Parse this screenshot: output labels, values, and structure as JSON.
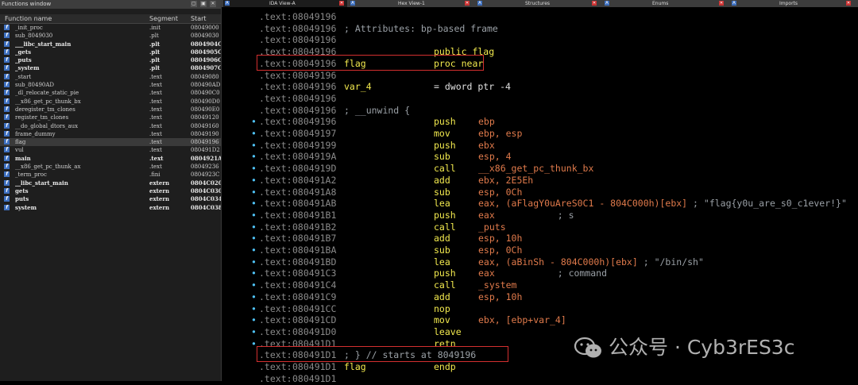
{
  "functions_window": {
    "title": "Functions window",
    "columns": {
      "name": "Function name",
      "segment": "Segment",
      "start": "Start"
    },
    "rows": [
      {
        "name": "_init_proc",
        "segment": ".init",
        "start": "08049000",
        "bold": false
      },
      {
        "name": "sub_8049030",
        "segment": ".plt",
        "start": "08049030",
        "bold": false
      },
      {
        "name": "___libc_start_main",
        "segment": ".plt",
        "start": "0804904C",
        "bold": true
      },
      {
        "name": "_gets",
        "segment": ".plt",
        "start": "0804905C",
        "bold": true
      },
      {
        "name": "_puts",
        "segment": ".plt",
        "start": "0804906C",
        "bold": true
      },
      {
        "name": "_system",
        "segment": ".plt",
        "start": "0804907C",
        "bold": true
      },
      {
        "name": "_start",
        "segment": ".text",
        "start": "08049080",
        "bold": false
      },
      {
        "name": "sub_80490AD",
        "segment": ".text",
        "start": "080490AD",
        "bold": false
      },
      {
        "name": "_dl_relocate_static_pie",
        "segment": ".text",
        "start": "080490C0",
        "bold": false
      },
      {
        "name": "__x86_get_pc_thunk_bx",
        "segment": ".text",
        "start": "080490D0",
        "bold": false
      },
      {
        "name": "deregister_tm_clones",
        "segment": ".text",
        "start": "080490E0",
        "bold": false
      },
      {
        "name": "register_tm_clones",
        "segment": ".text",
        "start": "08049120",
        "bold": false
      },
      {
        "name": "__do_global_dtors_aux",
        "segment": ".text",
        "start": "08049160",
        "bold": false
      },
      {
        "name": "frame_dummy",
        "segment": ".text",
        "start": "08049190",
        "bold": false
      },
      {
        "name": "flag",
        "segment": ".text",
        "start": "08049196",
        "bold": false,
        "selected": true
      },
      {
        "name": "vul",
        "segment": ".text",
        "start": "080491D2",
        "bold": false
      },
      {
        "name": "main",
        "segment": ".text",
        "start": "0804921A",
        "bold": true
      },
      {
        "name": "__x86_get_pc_thunk_ax",
        "segment": ".text",
        "start": "08049236",
        "bold": false
      },
      {
        "name": "_term_proc",
        "segment": ".fini",
        "start": "0804923C",
        "bold": false
      },
      {
        "name": "__libc_start_main",
        "segment": "extern",
        "start": "0804C020",
        "bold": true
      },
      {
        "name": "gets",
        "segment": "extern",
        "start": "0804C030",
        "bold": true
      },
      {
        "name": "puts",
        "segment": "extern",
        "start": "0804C034",
        "bold": true
      },
      {
        "name": "system",
        "segment": "extern",
        "start": "0804C038",
        "bold": true
      }
    ]
  },
  "tabs": [
    {
      "label": "IDA View-A",
      "active": true
    },
    {
      "label": "Hex View-1",
      "active": false
    },
    {
      "label": "Structures",
      "active": false
    },
    {
      "label": "Enums",
      "active": false
    },
    {
      "label": "Imports",
      "active": false
    }
  ],
  "disasm": [
    {
      "seg": ".text:",
      "addr": "08049196"
    },
    {
      "seg": ".text:",
      "addr": "08049196",
      "comment": "; Attributes: bp-based frame"
    },
    {
      "seg": ".text:",
      "addr": "08049196"
    },
    {
      "seg": ".text:",
      "addr": "08049196",
      "mnemonic": "public flag"
    },
    {
      "seg": ".text:",
      "addr": "08049196",
      "label": "flag",
      "mnemonic": "proc near"
    },
    {
      "seg": ".text:",
      "addr": "08049196"
    },
    {
      "seg": ".text:",
      "addr": "08049196",
      "label": "var_4",
      "mnemonic_raw": "= dword ptr -4"
    },
    {
      "seg": ".text:",
      "addr": "08049196"
    },
    {
      "seg": ".text:",
      "addr": "08049196",
      "comment": "; __unwind {"
    },
    {
      "seg": ".text:",
      "addr": "08049196",
      "dot": true,
      "mnemonic": "push",
      "operand": "ebp"
    },
    {
      "seg": ".text:",
      "addr": "08049197",
      "dot": true,
      "mnemonic": "mov",
      "operand": "ebp, esp"
    },
    {
      "seg": ".text:",
      "addr": "08049199",
      "dot": true,
      "mnemonic": "push",
      "operand": "ebx"
    },
    {
      "seg": ".text:",
      "addr": "0804919A",
      "dot": true,
      "mnemonic": "sub",
      "operand": "esp, 4"
    },
    {
      "seg": ".text:",
      "addr": "0804919D",
      "dot": true,
      "mnemonic": "call",
      "operand": "__x86_get_pc_thunk_bx"
    },
    {
      "seg": ".text:",
      "addr": "080491A2",
      "dot": true,
      "mnemonic": "add",
      "operand": "ebx, 2E5Eh"
    },
    {
      "seg": ".text:",
      "addr": "080491A8",
      "dot": true,
      "mnemonic": "sub",
      "operand": "esp, 0Ch"
    },
    {
      "seg": ".text:",
      "addr": "080491AB",
      "dot": true,
      "mnemonic": "lea",
      "operand": "eax, (aFlagY0uAreS0C1 - 804C000h)[ebx]",
      "comment": "; \"flag{y0u_are_s0_c1ever!}\""
    },
    {
      "seg": ".text:",
      "addr": "080491B1",
      "dot": true,
      "mnemonic": "push",
      "operand": "eax",
      "comment": "; s"
    },
    {
      "seg": ".text:",
      "addr": "080491B2",
      "dot": true,
      "mnemonic": "call",
      "operand": "_puts"
    },
    {
      "seg": ".text:",
      "addr": "080491B7",
      "dot": true,
      "mnemonic": "add",
      "operand": "esp, 10h"
    },
    {
      "seg": ".text:",
      "addr": "080491BA",
      "dot": true,
      "mnemonic": "sub",
      "operand": "esp, 0Ch"
    },
    {
      "seg": ".text:",
      "addr": "080491BD",
      "dot": true,
      "mnemonic": "lea",
      "operand": "eax, (aBinSh - 804C000h)[ebx]",
      "comment": "; \"/bin/sh\""
    },
    {
      "seg": ".text:",
      "addr": "080491C3",
      "dot": true,
      "mnemonic": "push",
      "operand": "eax",
      "comment": "; command"
    },
    {
      "seg": ".text:",
      "addr": "080491C4",
      "dot": true,
      "mnemonic": "call",
      "operand": "_system"
    },
    {
      "seg": ".text:",
      "addr": "080491C9",
      "dot": true,
      "mnemonic": "add",
      "operand": "esp, 10h"
    },
    {
      "seg": ".text:",
      "addr": "080491CC",
      "dot": true,
      "mnemonic": "nop"
    },
    {
      "seg": ".text:",
      "addr": "080491CD",
      "dot": true,
      "mnemonic": "mov",
      "operand": "ebx, [ebp+var_4]"
    },
    {
      "seg": ".text:",
      "addr": "080491D0",
      "dot": true,
      "mnemonic": "leave"
    },
    {
      "seg": ".text:",
      "addr": "080491D1",
      "dot": true,
      "mnemonic": "retn"
    },
    {
      "seg": ".text:",
      "addr": "080491D1",
      "comment": "; } // starts at 8049196"
    },
    {
      "seg": ".text:",
      "addr": "080491D1",
      "label": "flag",
      "mnemonic": "endp"
    },
    {
      "seg": ".text:",
      "addr": "080491D1"
    }
  ],
  "watermark": {
    "text": "公众号 · Cyb3rES3c",
    "icon": "wechat-icon"
  },
  "colors": {
    "highlight_box": "#d32f2f",
    "keyword": "#f2e94e",
    "operand_num": "#e07a4b",
    "dim": "#8a8a8a"
  }
}
